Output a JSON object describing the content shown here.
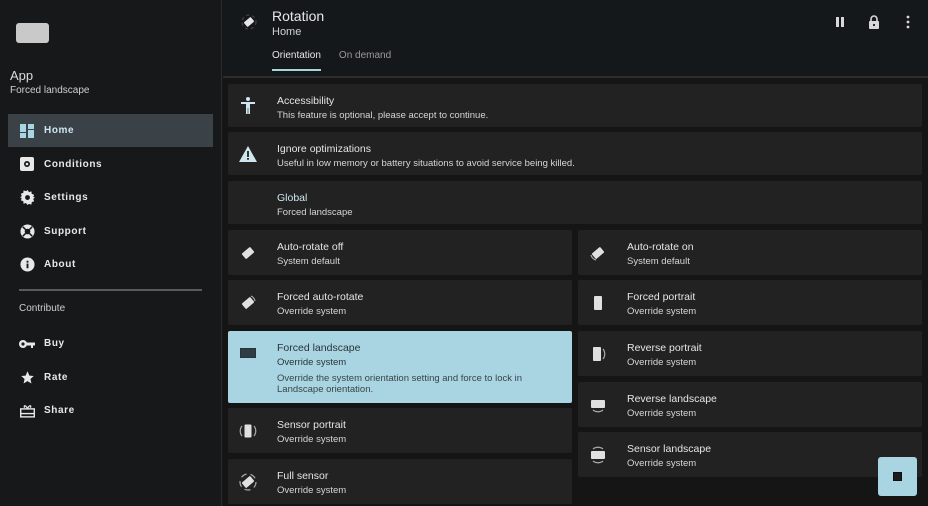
{
  "sidebar": {
    "app_title": "App",
    "app_subtitle": "Forced landscape",
    "items": [
      {
        "label": "Home",
        "icon": "dashboard-icon",
        "active": true
      },
      {
        "label": "Conditions",
        "icon": "conditions-icon"
      },
      {
        "label": "Settings",
        "icon": "gear-icon"
      },
      {
        "label": "Support",
        "icon": "lifebuoy-icon"
      },
      {
        "label": "About",
        "icon": "info-icon"
      }
    ],
    "section_label": "Contribute",
    "contribute_items": [
      {
        "label": "Buy",
        "icon": "key-icon"
      },
      {
        "label": "Rate",
        "icon": "star-icon"
      },
      {
        "label": "Share",
        "icon": "gift-icon"
      }
    ]
  },
  "header": {
    "title": "Rotation",
    "subtitle": "Home",
    "actions": [
      "pause-icon",
      "lock-icon",
      "more-vert-icon"
    ],
    "tabs": [
      {
        "label": "Orientation",
        "active": true
      },
      {
        "label": "On demand",
        "active": false
      }
    ]
  },
  "cards": {
    "accessibility": {
      "title": "Accessibility",
      "subtitle": "This feature is optional, please accept to continue."
    },
    "optimizations": {
      "title": "Ignore optimizations",
      "subtitle": "Useful in low memory or battery situations to avoid service being killed."
    },
    "global": {
      "title": "Global",
      "subtitle": "Forced landscape"
    }
  },
  "orientations": {
    "left": [
      {
        "title": "Auto-rotate off",
        "subtitle": "System default"
      },
      {
        "title": "Forced auto-rotate",
        "subtitle": "Override system"
      },
      {
        "title": "Forced landscape",
        "subtitle": "Override system",
        "description": "Override the system orientation setting and force to lock in Landscape orientation.",
        "selected": true
      },
      {
        "title": "Sensor portrait",
        "subtitle": "Override system"
      },
      {
        "title": "Full sensor",
        "subtitle": "Override system"
      }
    ],
    "right": [
      {
        "title": "Auto-rotate on",
        "subtitle": "System default"
      },
      {
        "title": "Forced portrait",
        "subtitle": "Override system"
      },
      {
        "title": "Reverse portrait",
        "subtitle": "Override system"
      },
      {
        "title": "Reverse landscape",
        "subtitle": "Override system"
      },
      {
        "title": "Sensor landscape",
        "subtitle": "Override system"
      }
    ]
  },
  "colors": {
    "accent": "#a9d5e2",
    "sidebar_active": "#3a4248",
    "card_bg": "#222222"
  },
  "fab": {
    "icon": "stop-icon"
  }
}
